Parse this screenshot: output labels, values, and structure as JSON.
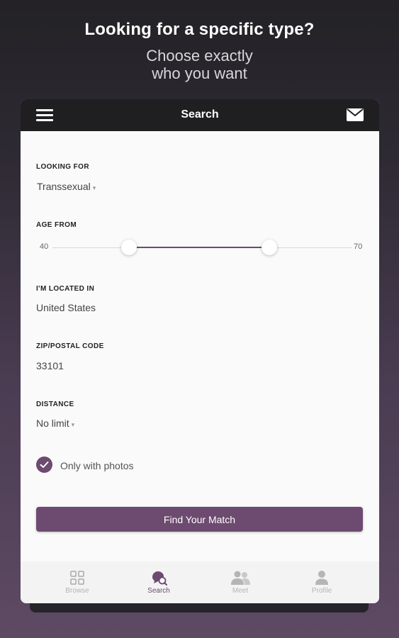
{
  "promo": {
    "title": "Looking for a specific type?",
    "subtitle_line1": "Choose exactly",
    "subtitle_line2": "who you want"
  },
  "appbar": {
    "title": "Search"
  },
  "form": {
    "looking_for": {
      "label": "LOOKING FOR",
      "value": "Transsexual"
    },
    "age": {
      "label": "AGE FROM",
      "min_label": "40",
      "max_label": "70"
    },
    "location": {
      "label": "I'M LOCATED IN",
      "value": "United States"
    },
    "zip": {
      "label": "ZIP/POSTAL CODE",
      "value": "33101"
    },
    "distance": {
      "label": "DISTANCE",
      "value": "No limit"
    },
    "photos_only": {
      "label": "Only with photos",
      "checked": true
    },
    "submit_label": "Find Your Match"
  },
  "bottom_nav": [
    {
      "label": "Browse",
      "icon": "grid-icon",
      "active": false
    },
    {
      "label": "Search",
      "icon": "search-chat-icon",
      "active": true
    },
    {
      "label": "Meet",
      "icon": "people-icon",
      "active": false
    },
    {
      "label": "Profile",
      "icon": "person-icon",
      "active": false
    }
  ],
  "colors": {
    "accent": "#6d4a70",
    "appbar": "#1f1f22",
    "inactive_nav": "#b5b5b5"
  }
}
